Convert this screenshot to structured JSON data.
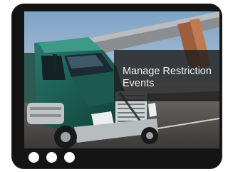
{
  "slide": {
    "caption": "Manage Restriction Events",
    "image_label": "Green semi-truck driving on highway under overpass"
  },
  "pager": {
    "dots": [
      "slide-1",
      "slide-2",
      "slide-3"
    ]
  },
  "colors": {
    "frame": "#141414",
    "caption_panel": "#1e1e1e",
    "caption_text": "#f2f2f2",
    "dot": "#ffffff",
    "truck": "#14463f"
  }
}
